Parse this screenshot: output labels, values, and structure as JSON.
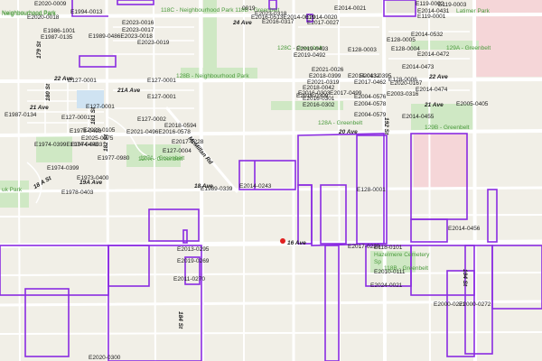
{
  "theme": {
    "land": "#f1efe7",
    "road": "#ffffff",
    "parcel": "#8a2be2",
    "greenbelt": "#cfe8c4",
    "pink": "#f5d6d8",
    "marker": "#e02020",
    "label": "#1c1c1c",
    "green_label": "#4a9a3c"
  },
  "roads": {
    "r22ave_a": "22 Ave",
    "r22ave_b": "22 Ave",
    "r21ave": "21 Ave",
    "r21ave_b": "21 Ave",
    "r21a": "21A Ave",
    "r20ave": "20 Ave",
    "r19a": "19A Ave",
    "r18ave": "18 Ave",
    "r16ave": "16 Ave",
    "r24ave": "24 Ave",
    "r179": "179 St",
    "r180": "180 St",
    "r181": "181 St",
    "r182": "182 St",
    "r184": "184 St",
    "r192": "192 St",
    "r194": "194 St",
    "mcmillan": "McMillan Rd",
    "r18a_st": "18 A St"
  },
  "green": {
    "g1": "Neighbourhood Park",
    "g2": "118C - Neighbourhood Park 118B - Greenbelt",
    "g3": "128B - Neighbourhood Park",
    "g4": "127A - Greenbelt",
    "g5": "128C - Greenbelt",
    "g6": "127A - Greenbelt",
    "g7": "128A - Greenbelt",
    "g8": "129B - Greenbelt",
    "g9": "Latimer Park",
    "g10": "Hazelmere Cemetery",
    "g11": "Sp",
    "g12": "118B - Greenbelt",
    "g13": "129A - Greenbelt",
    "g14": "uk Park",
    "g15": "Neighbourhood Park"
  },
  "labels": {
    "l01": "E2020-0009",
    "l02": "E2020-0018",
    "l03": "E1994-0013",
    "l04": "E1986-1001",
    "l05": "E1987-0135",
    "l06": "E2023-0016",
    "l07": "E2023-0017",
    "l08": "E1989-0486E2023-0018",
    "l09": "E2023-0019",
    "l10": "E2023-0318",
    "l11": "E2016-0513E2014-0019",
    "l12": "E2014-0020",
    "l13": "E2016-0317",
    "l14": "E2014-0021",
    "l15": "E2017-0027",
    "l16": "0019",
    "l17": "E2019-0493",
    "l18": "E2019-0492",
    "l19": "E128-0003",
    "l20": "E128-0005",
    "l21": "E127-0001",
    "l22": "E127-0001",
    "l23": "E127-0001",
    "l24": "E127-0001",
    "l25": "E127-0001",
    "l26": "E127-0002",
    "l27": "E1987-0134",
    "l28": "E2021-0026",
    "l29": "E2018-0399",
    "l30": "E2014-0432",
    "l31": "E2021-0319",
    "l32": "E2017-0462",
    "l33": "E2018-0042",
    "l34": "E2016-0303",
    "l35": "E2016-0301",
    "l36": "E2016-0302",
    "l37": "E2017-0499",
    "l38": "E2013-0395",
    "l39": "E2004-0576",
    "l40": "E2004-0578",
    "l41": "E2004-0579",
    "l42": "E128-0006",
    "l43": "E128-0004",
    "l44": "E119-0001",
    "l45": "E119-0002",
    "l46": "E119-0003",
    "l47": "E2014-0532",
    "l48": "E2014-0431",
    "l49": "E2014-0472",
    "l50": "E2014-0473",
    "l51": "E2014-0474",
    "l52": "E2020-0167",
    "l53": "E2003-0316",
    "l54": "E2005-0405",
    "l55": "E2014-0455",
    "l56": "E1974-0399E1974-0403",
    "l57": "E1974-0399",
    "l58": "E1978-0493",
    "l59": "E2018-0594",
    "l60": "E2025-0075",
    "l61": "E2021-0496E2016-0578",
    "l62": "E2017-0228",
    "l63": "E127-0004",
    "l64": "E1977-0980",
    "l65": "E2023-0105",
    "l66": "E1973-0400",
    "l67": "E1974-0403",
    "l68": "E1978-0403",
    "l69": "E1989-0339",
    "l70": "E2014-0243",
    "l71": "E128-0001",
    "l72": "E2014-0456",
    "l73": "E2013-0295",
    "l74": "E2019-0269",
    "l75": "E2011-0270",
    "l76": "E2017-0229",
    "l77": "E118-0101",
    "l78": "E2010-0111",
    "l79": "E2024-0021",
    "l80": "E2000-0271",
    "l81": "E2000-0272",
    "l82": "E2020-0300",
    "l83": "E2016-0309"
  }
}
